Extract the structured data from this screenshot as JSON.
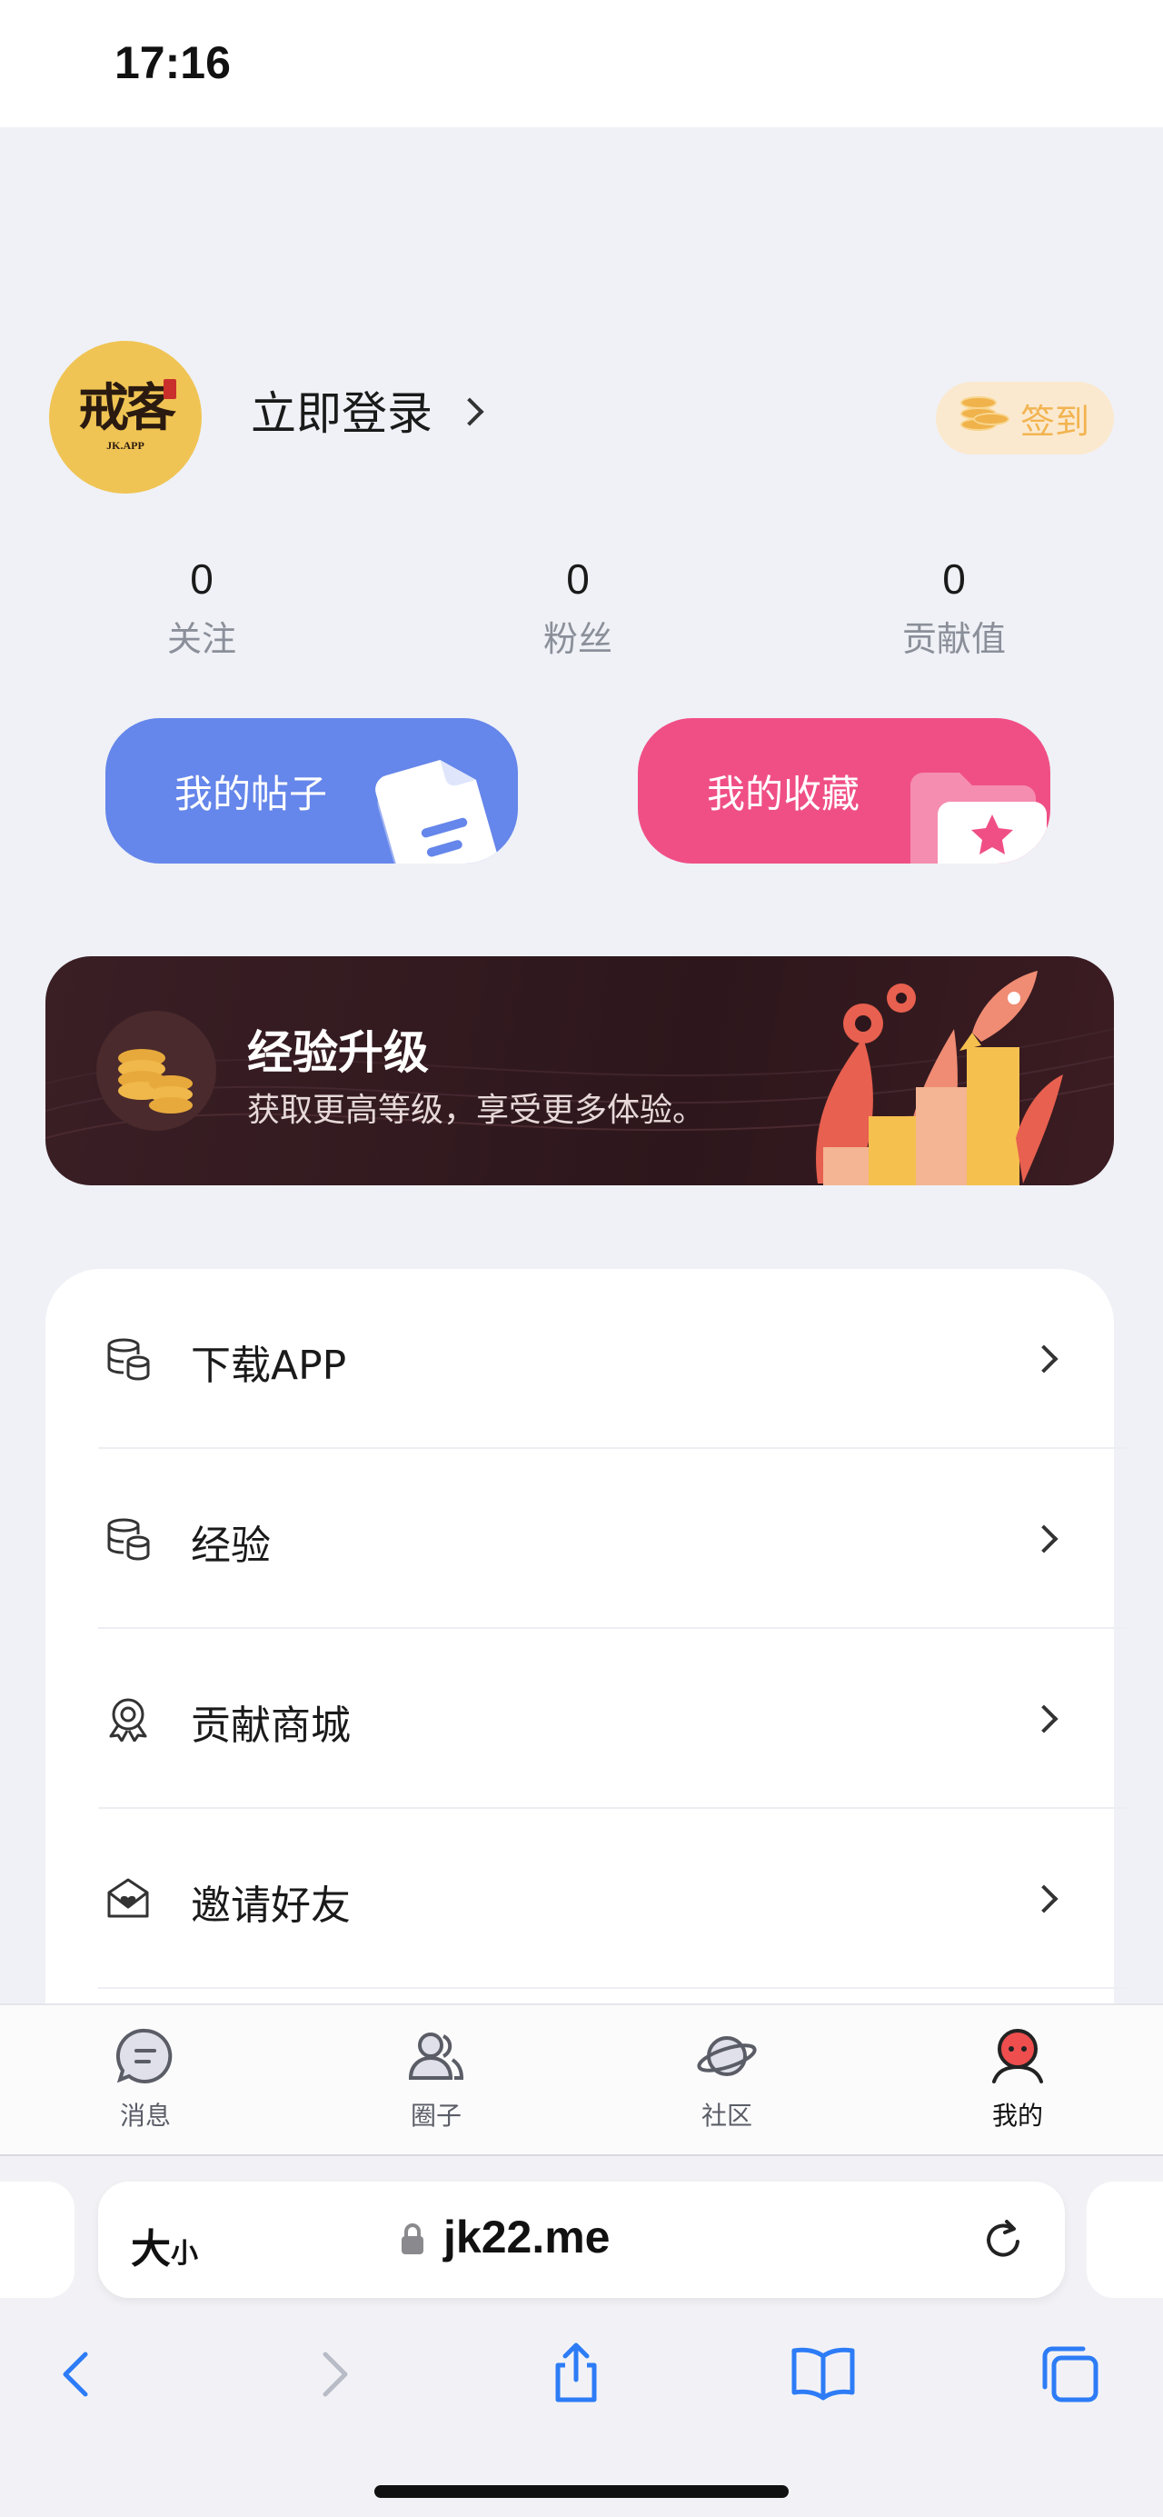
{
  "status_bar": {
    "time": "17:16"
  },
  "profile": {
    "avatar_text": "戒客",
    "avatar_sub": "JK.APP",
    "login_label": "立即登录",
    "signin_label": "签到"
  },
  "stats": [
    {
      "value": "0",
      "label": "关注"
    },
    {
      "value": "0",
      "label": "粉丝"
    },
    {
      "value": "0",
      "label": "贡献值"
    }
  ],
  "quick_cards": {
    "posts_label": "我的帖子",
    "favorites_label": "我的收藏"
  },
  "banner": {
    "title": "经验升级",
    "subtitle": "获取更高等级，享受更多体验。"
  },
  "menu": [
    {
      "label": "下载APP",
      "icon": "database-icon"
    },
    {
      "label": "经验",
      "icon": "database-icon"
    },
    {
      "label": "贡献商城",
      "icon": "badge-icon"
    },
    {
      "label": "邀请好友",
      "icon": "mail-heart-icon"
    }
  ],
  "tabbar": [
    {
      "label": "消息",
      "icon": "message-icon"
    },
    {
      "label": "圈子",
      "icon": "group-icon"
    },
    {
      "label": "社区",
      "icon": "planet-icon"
    },
    {
      "label": "我的",
      "icon": "profile-icon",
      "active": true
    }
  ],
  "browser": {
    "text_size_big": "大",
    "text_size_small": "小",
    "domain": "jk22.me"
  },
  "colors": {
    "posts_card": "#6586ea",
    "favorites_card": "#f04f86",
    "signin_bg": "#fbe9cf",
    "signin_text": "#f2b451",
    "banner_bg": "#2d171c",
    "active_tab_accent": "#ee4e4e"
  }
}
